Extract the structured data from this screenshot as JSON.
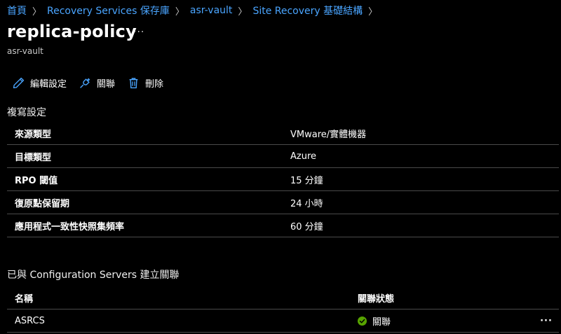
{
  "breadcrumb": {
    "items": [
      "首頁",
      "Recovery Services 保存庫",
      "asr-vault",
      "Site Recovery 基礎結構"
    ],
    "separator": "〉"
  },
  "header": {
    "title": "replica-policy",
    "more": "···",
    "subtitle": "asr-vault"
  },
  "toolbar": {
    "edit_label": "編輯設定",
    "associate_label": "關聯",
    "delete_label": "刪除"
  },
  "replication": {
    "section_title": "複寫設定",
    "rows": [
      {
        "label": "來源類型",
        "value": "VMware/實體機器"
      },
      {
        "label": "目標類型",
        "value": "Azure"
      },
      {
        "label": "RPO 閾值",
        "value": "15 分鐘"
      },
      {
        "label": "復原點保留期",
        "value": "24 小時"
      },
      {
        "label": "應用程式一致性快照集頻率",
        "value": "60 分鐘"
      }
    ]
  },
  "associations": {
    "section_title": "已與 Configuration Servers 建立關聯",
    "columns": [
      "名稱",
      "關聯狀態"
    ],
    "rows": [
      {
        "name": "ASRCS",
        "status": "關聯",
        "more": "···"
      }
    ]
  },
  "colors": {
    "link": "#4aa5ff",
    "success": "#57a300",
    "background": "#000000"
  }
}
